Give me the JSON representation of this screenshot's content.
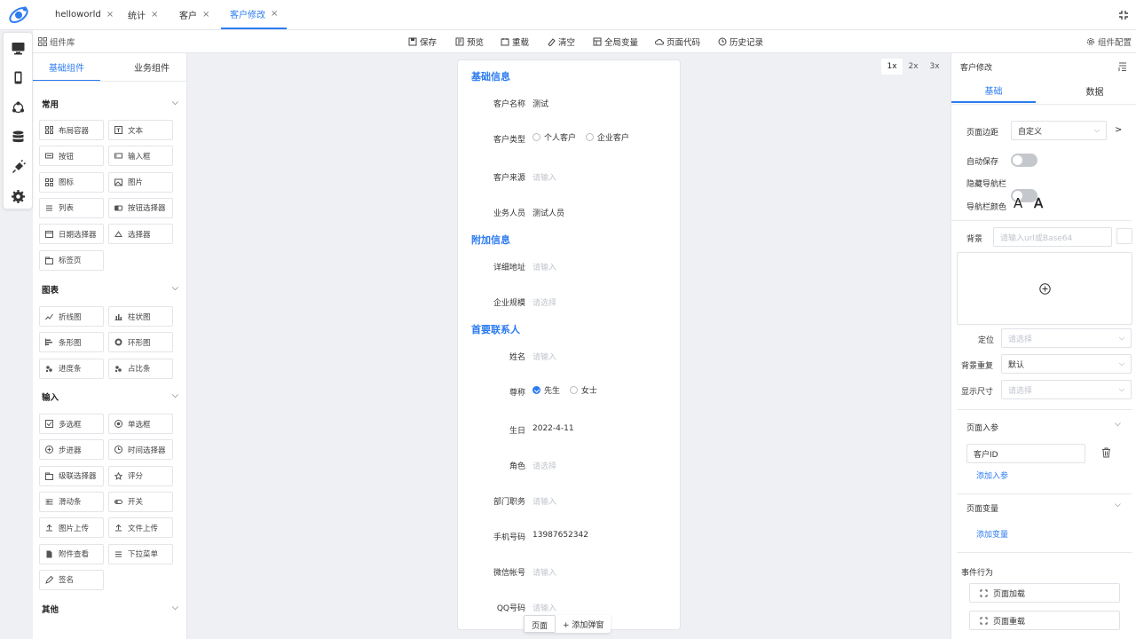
{
  "tabs": [
    {
      "label": "helloworld",
      "close": "×"
    },
    {
      "label": "统计",
      "close": "×"
    },
    {
      "label": "客户",
      "close": "×"
    },
    {
      "label": "客户修改",
      "close": "×"
    }
  ],
  "toolbar": {
    "library_label": "组件库",
    "save": "保存",
    "preview": "预览",
    "reload": "重载",
    "clear": "清空",
    "global_vars": "全局变量",
    "page_code": "页面代码",
    "history": "历史记录",
    "config": "组件配置"
  },
  "component_panel": {
    "tabs": [
      "基础组件",
      "业务组件"
    ],
    "groups": [
      {
        "title": "常用",
        "items": [
          "布局容器",
          "文本",
          "按钮",
          "输入框",
          "图标",
          "图片",
          "列表",
          "按钮选择器",
          "日期选择器",
          "选择器",
          "标签页"
        ]
      },
      {
        "title": "图表",
        "items": [
          "折线图",
          "柱状图",
          "条形图",
          "环形图",
          "进度条",
          "占比条"
        ]
      },
      {
        "title": "输入",
        "items": [
          "多选框",
          "单选框",
          "步进器",
          "时间选择器",
          "级联选择器",
          "评分",
          "滑动条",
          "开关",
          "图片上传",
          "文件上传",
          "附件查看",
          "下拉菜单",
          "签名"
        ]
      },
      {
        "title": "其他",
        "items": []
      }
    ]
  },
  "canvas": {
    "zoom": [
      "1x",
      "2x",
      "3x"
    ],
    "sections": {
      "basic": "基础信息",
      "extra": "附加信息",
      "contact": "首要联系人"
    },
    "fields": {
      "name_label": "客户名称",
      "name_value": "测试",
      "type_label": "客户类型",
      "type_opt1": "个人客户",
      "type_opt2": "企业客户",
      "source_label": "客户来源",
      "source_ph": "请输入",
      "staff_label": "业务人员",
      "staff_value": "测试人员",
      "addr_label": "详细地址",
      "addr_ph": "请输入",
      "scale_label": "企业规模",
      "scale_ph": "请选择",
      "cname_label": "姓名",
      "cname_ph": "请输入",
      "title_label": "尊称",
      "title_opt1": "先生",
      "title_opt2": "女士",
      "birth_label": "生日",
      "birth_value": "2022-4-11",
      "role_label": "角色",
      "role_ph": "请选择",
      "dept_label": "部门职务",
      "dept_ph": "请输入",
      "phone_label": "手机号码",
      "phone_value": "13987652342",
      "wechat_label": "微信帐号",
      "wechat_ph": "请输入",
      "qq_label": "QQ号码",
      "qq_ph": "请输入"
    },
    "bottom_tabs": [
      "页面",
      "+ 添加弹窗"
    ]
  },
  "right_panel": {
    "title": "客户修改",
    "tabs": [
      "基础",
      "数据"
    ],
    "margin_label": "页面边距",
    "margin_value": "自定义",
    "arrow": ">",
    "autosave_label": "自动保存",
    "hidenav_label": "隐藏导航栏",
    "navcolor_label": "导航栏颜色",
    "navcolor_a": "A",
    "bg_label": "背景",
    "bg_ph": "请输入url或Base64",
    "position_label": "定位",
    "position_ph": "请选择",
    "repeat_label": "背景重复",
    "repeat_value": "默认",
    "size_label": "显示尺寸",
    "size_ph": "请选择",
    "params_title": "页面入参",
    "param_value": "客户ID",
    "add_param": "添加入参",
    "vars_title": "页面变量",
    "add_var": "添加变量",
    "events_title": "事件行为",
    "event1": "页面加载",
    "event2": "页面重载"
  },
  "colors": {
    "accent": "#2d7cf0"
  }
}
